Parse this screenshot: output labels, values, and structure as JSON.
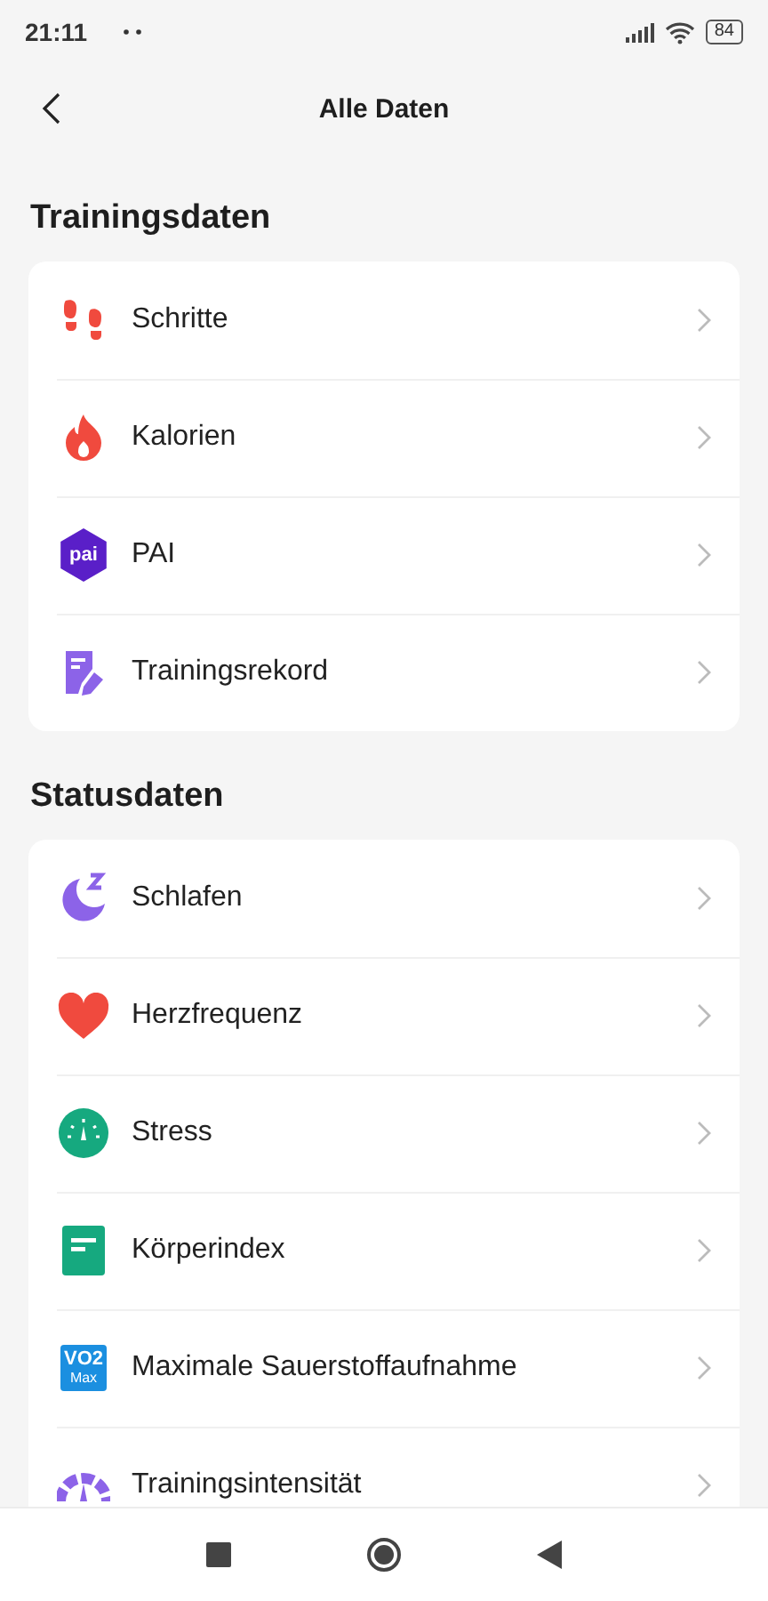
{
  "status_bar": {
    "time": "21:11",
    "battery": "84"
  },
  "header": {
    "title": "Alle Daten"
  },
  "sections": [
    {
      "title": "Trainingsdaten",
      "items": [
        {
          "kind": "steps",
          "label": "Schritte"
        },
        {
          "kind": "flame",
          "label": "Kalorien"
        },
        {
          "kind": "pai",
          "label": "PAI",
          "icon_text": "pai"
        },
        {
          "kind": "record",
          "label": "Trainingsrekord"
        }
      ]
    },
    {
      "title": "Statusdaten",
      "items": [
        {
          "kind": "sleep",
          "label": "Schlafen"
        },
        {
          "kind": "heart",
          "label": "Herzfrequenz"
        },
        {
          "kind": "stress",
          "label": "Stress"
        },
        {
          "kind": "body",
          "label": "Körperindex"
        },
        {
          "kind": "vo2",
          "label": "Maximale Sauerstoffaufnahme",
          "icon_text": "VO2",
          "icon_subtext": "Max"
        },
        {
          "kind": "intensity",
          "label": "Trainingsintensität"
        }
      ]
    }
  ]
}
